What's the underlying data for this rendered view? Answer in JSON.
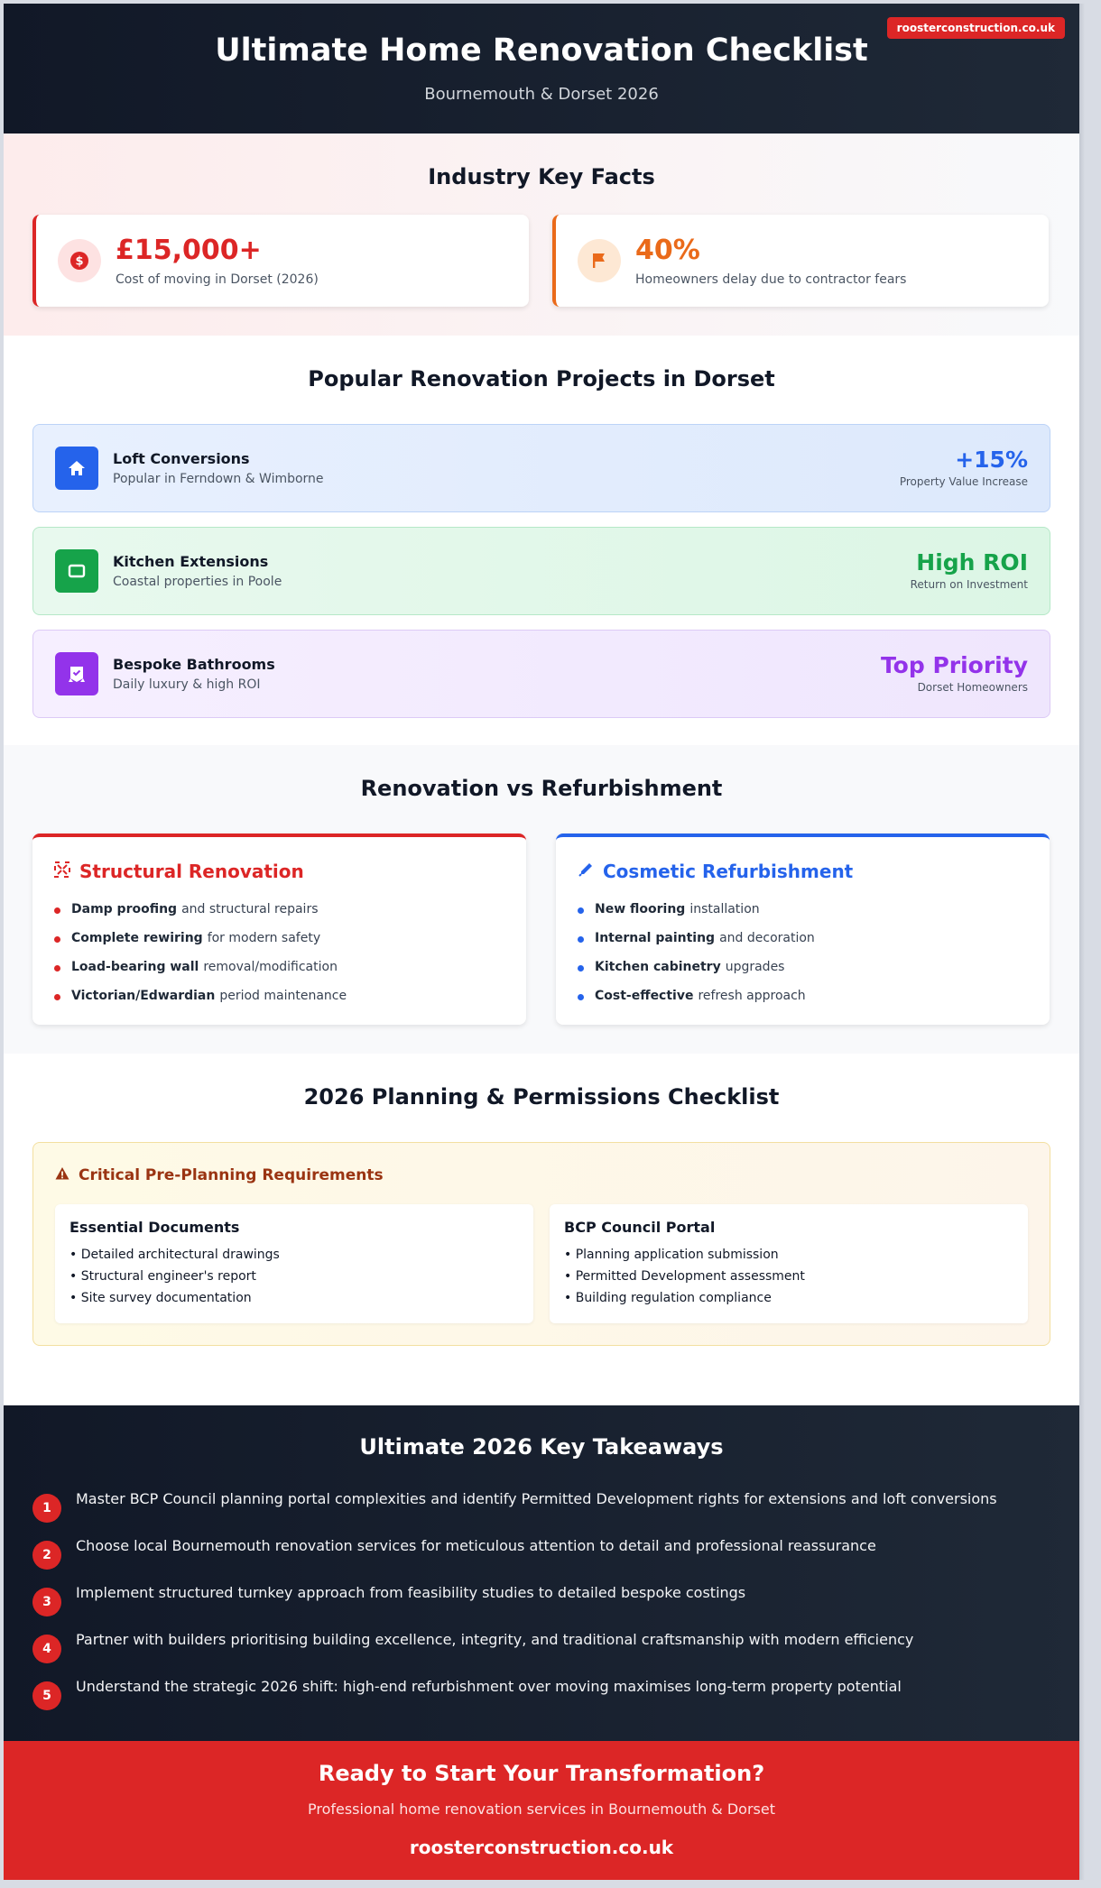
{
  "header": {
    "badge": "roosterconstruction.co.uk",
    "title": "Ultimate Home Renovation Checklist",
    "subtitle": "Bournemouth & Dorset 2026"
  },
  "facts": {
    "title": "Industry Key Facts",
    "items": [
      {
        "value": "£15,000+",
        "desc": "Cost of moving in Dorset (2026)",
        "icon": "pound-coin-icon",
        "color": "#dc2626"
      },
      {
        "value": "40%",
        "desc": "Homeowners delay due to contractor fears",
        "icon": "flag-icon",
        "color": "#ea6a1a"
      }
    ]
  },
  "projects": {
    "title": "Popular Renovation Projects in Dorset",
    "items": [
      {
        "name": "Loft Conversions",
        "sub": "Popular in Ferndown & Wimborne",
        "stat": "+15%",
        "stat_label": "Property Value Increase",
        "icon": "house-icon",
        "color": "#2563eb"
      },
      {
        "name": "Kitchen Extensions",
        "sub": "Coastal properties in Poole",
        "stat": "High ROI",
        "stat_label": "Return on Investment",
        "icon": "cabinet-icon",
        "color": "#16a34a"
      },
      {
        "name": "Bespoke Bathrooms",
        "sub": "Daily luxury & high ROI",
        "stat": "Top Priority",
        "stat_label": "Dorset Homeowners",
        "icon": "award-icon",
        "color": "#9333ea"
      }
    ]
  },
  "versus": {
    "title": "Renovation vs Refurbishment",
    "renovation": {
      "title": "Structural Renovation",
      "icon": "expand-arrows-icon",
      "items": [
        {
          "bold": "Damp proofing",
          "rest": "and structural repairs"
        },
        {
          "bold": "Complete rewiring",
          "rest": "for modern safety"
        },
        {
          "bold": "Load-bearing wall",
          "rest": "removal/modification"
        },
        {
          "bold": "Victorian/Edwardian",
          "rest": "period maintenance"
        }
      ]
    },
    "refurbishment": {
      "title": "Cosmetic Refurbishment",
      "icon": "paintbrush-icon",
      "items": [
        {
          "bold": "New flooring",
          "rest": "installation"
        },
        {
          "bold": "Internal painting",
          "rest": "and decoration"
        },
        {
          "bold": "Kitchen cabinetry",
          "rest": "upgrades"
        },
        {
          "bold": "Cost-effective",
          "rest": "refresh approach"
        }
      ]
    }
  },
  "planning": {
    "title": "2026 Planning & Permissions Checklist",
    "box_title": "Critical Pre-Planning Requirements",
    "documents": {
      "title": "Essential Documents",
      "items": [
        "• Detailed architectural drawings",
        "• Structural engineer's report",
        "• Site survey documentation"
      ]
    },
    "portal": {
      "title": "BCP Council Portal",
      "items": [
        "• Planning application submission",
        "• Permitted Development assessment",
        "• Building regulation compliance"
      ]
    }
  },
  "takeaways": {
    "title": "Ultimate 2026 Key Takeaways",
    "items": [
      {
        "num": "1",
        "text": "Master BCP Council planning portal complexities and identify Permitted Development rights for extensions and loft conversions"
      },
      {
        "num": "2",
        "text": "Choose local Bournemouth renovation services for meticulous attention to detail and professional reassurance"
      },
      {
        "num": "3",
        "text": "Implement structured turnkey approach from feasibility studies to detailed bespoke costings"
      },
      {
        "num": "4",
        "text": "Partner with builders prioritising building excellence, integrity, and traditional craftsmanship with modern efficiency"
      },
      {
        "num": "5",
        "text": "Understand the strategic 2026 shift: high-end refurbishment over moving maximises long-term property potential"
      }
    ]
  },
  "cta": {
    "title": "Ready to Start Your Transformation?",
    "subtitle": "Professional home renovation services in Bournemouth & Dorset",
    "link": "roosterconstruction.co.uk"
  }
}
